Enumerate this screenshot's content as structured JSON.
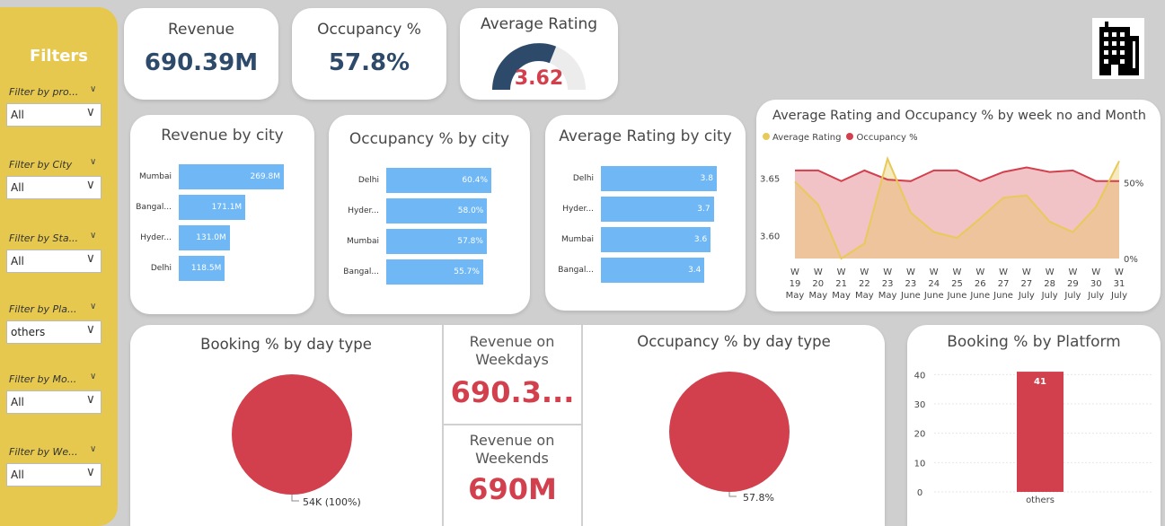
{
  "filters": {
    "title": "Filters",
    "items": [
      {
        "label": "Filter by pro...",
        "value": "All"
      },
      {
        "label": "Filter by City",
        "value": "All"
      },
      {
        "label": "Filter by Sta...",
        "value": "All"
      },
      {
        "label": "Filter by Pla...",
        "value": "others"
      },
      {
        "label": "Filter by Mo...",
        "value": "All"
      },
      {
        "label": "Filter by We...",
        "value": "All"
      }
    ]
  },
  "kpis": {
    "revenue": {
      "label": "Revenue",
      "value": "690.39M"
    },
    "occupancy": {
      "label": "Occupancy %",
      "value": "57.8%"
    },
    "rating": {
      "label": "Average Rating",
      "value": "3.62",
      "gauge_fraction": 0.62
    }
  },
  "revenue_by_city": {
    "title": "Revenue by city",
    "rows": [
      {
        "city": "Mumbai",
        "label": "269.8M",
        "value": 269.8
      },
      {
        "city": "Bangal...",
        "label": "171.1M",
        "value": 171.1
      },
      {
        "city": "Hyder...",
        "label": "131.0M",
        "value": 131.0
      },
      {
        "city": "Delhi",
        "label": "118.5M",
        "value": 118.5
      }
    ]
  },
  "occupancy_by_city": {
    "title": "Occupancy % by city",
    "rows": [
      {
        "city": "Delhi",
        "label": "60.4%",
        "value": 60.4
      },
      {
        "city": "Hyder...",
        "label": "58.0%",
        "value": 58.0
      },
      {
        "city": "Mumbai",
        "label": "57.8%",
        "value": 57.8
      },
      {
        "city": "Bangal...",
        "label": "55.7%",
        "value": 55.7
      }
    ]
  },
  "rating_by_city": {
    "title": "Average Rating by city",
    "rows": [
      {
        "city": "Delhi",
        "label": "3.8",
        "value": 3.8
      },
      {
        "city": "Hyder...",
        "label": "3.7",
        "value": 3.7
      },
      {
        "city": "Mumbai",
        "label": "3.6",
        "value": 3.6
      },
      {
        "city": "Bangal...",
        "label": "3.4",
        "value": 3.4
      }
    ]
  },
  "weekly_chart": {
    "title": "Average Rating and Occupancy % by week no and Month",
    "legend": [
      {
        "name": "Average Rating",
        "color": "#e8c95a"
      },
      {
        "name": "Occupancy %",
        "color": "#d2404d"
      }
    ]
  },
  "revenue_weekdays": {
    "label": "Revenue on Weekdays",
    "value": "690.3..."
  },
  "revenue_weekends": {
    "label": "Revenue on Weekends",
    "value": "690M"
  },
  "booking_day_type": {
    "title": "Booking % by day type",
    "label": "54K (100%)"
  },
  "occupancy_day_type": {
    "title": "Occupancy % by day type",
    "label": "57.8%"
  },
  "booking_platform": {
    "title": "Booking % by Platform"
  },
  "colors": {
    "accent": "#d2404d",
    "navy": "#2e4a6b",
    "bar": "#6fb7f5",
    "filter_bg": "#e6c84f"
  },
  "chart_data": [
    {
      "type": "line",
      "title": "Average Rating and Occupancy % by week no and Month",
      "x": [
        "W 19 May",
        "W 20 May",
        "W 21 May",
        "W 22 May",
        "W 23 May",
        "W 23 June",
        "W 24 June",
        "W 25 June",
        "W 26 June",
        "W 27 June",
        "W 27 July",
        "W 28 July",
        "W 29 July",
        "W 30 July",
        "W 31 July"
      ],
      "series": [
        {
          "name": "Average Rating",
          "axis": "left",
          "values": [
            3.647,
            3.627,
            3.58,
            3.593,
            3.667,
            3.62,
            3.603,
            3.598,
            3.615,
            3.633,
            3.635,
            3.612,
            3.603,
            3.625,
            3.665
          ]
        },
        {
          "name": "Occupancy %",
          "axis": "right",
          "values": [
            58,
            58,
            51,
            58,
            52,
            51,
            58,
            58,
            51,
            57,
            60,
            57,
            58,
            51,
            51
          ]
        }
      ],
      "left_ticks": [
        "3.65",
        "3.60"
      ],
      "right_ticks": [
        "50%",
        "0%"
      ],
      "left_ylim": [
        3.58,
        3.67
      ],
      "right_ylim": [
        0,
        68
      ]
    },
    {
      "type": "bar",
      "title": "Booking % by Platform",
      "categories": [
        "others"
      ],
      "values": [
        41
      ],
      "data_labels": [
        "41"
      ],
      "y_ticks": [
        "40",
        "30",
        "20",
        "10",
        "0"
      ],
      "ylim": [
        0,
        45
      ]
    },
    {
      "type": "pie",
      "title": "Booking % by day type",
      "values": [
        100
      ],
      "data_labels": [
        "54K (100%)"
      ]
    },
    {
      "type": "pie",
      "title": "Occupancy % by day type",
      "values": [
        100
      ],
      "data_labels": [
        "57.8%"
      ]
    }
  ]
}
